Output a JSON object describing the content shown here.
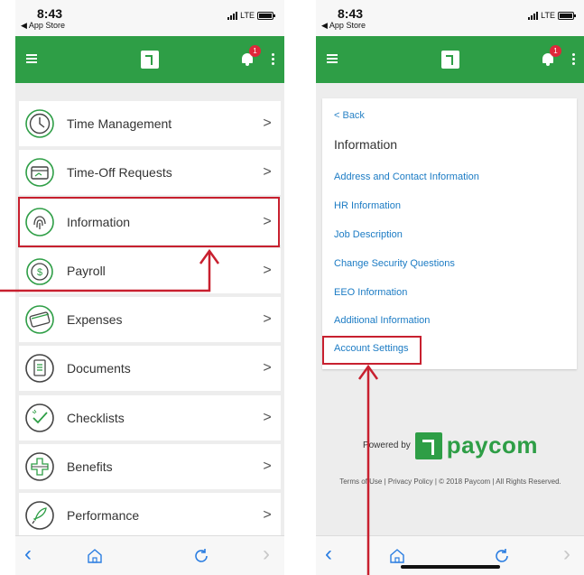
{
  "colors": {
    "brand_green": "#2e9e46",
    "link_blue": "#1b7bc4",
    "callout_red": "#c8202f",
    "badge_red": "#e0263a"
  },
  "status_bar": {
    "time": "8:43",
    "back_app": "◀ App Store",
    "carrier": "LTE"
  },
  "notification_count": "1",
  "left_screen": {
    "menu_items": [
      {
        "label": "Time Management",
        "icon": "clock-icon"
      },
      {
        "label": "Time-Off Requests",
        "icon": "time-off-icon"
      },
      {
        "label": "Information",
        "icon": "fingerprint-icon"
      },
      {
        "label": "Payroll",
        "icon": "payroll-icon"
      },
      {
        "label": "Expenses",
        "icon": "credit-card-icon"
      },
      {
        "label": "Documents",
        "icon": "document-icon"
      },
      {
        "label": "Checklists",
        "icon": "checklist-icon"
      },
      {
        "label": "Benefits",
        "icon": "benefits-icon"
      },
      {
        "label": "Performance",
        "icon": "rocket-icon"
      }
    ],
    "chevron": ">"
  },
  "right_screen": {
    "back_label": "< Back",
    "title": "Information",
    "links": [
      "Address and Contact Information",
      "HR Information",
      "Job Description",
      "Change Security Questions",
      "EEO Information",
      "Additional Information",
      "Account Settings"
    ],
    "powered_by": "Powered by",
    "brand": "paycom",
    "terms": "Terms of Use | Privacy Policy | © 2018 Paycom | All Rights Reserved."
  },
  "browser_nav": {
    "back": "‹",
    "forward": "›"
  }
}
